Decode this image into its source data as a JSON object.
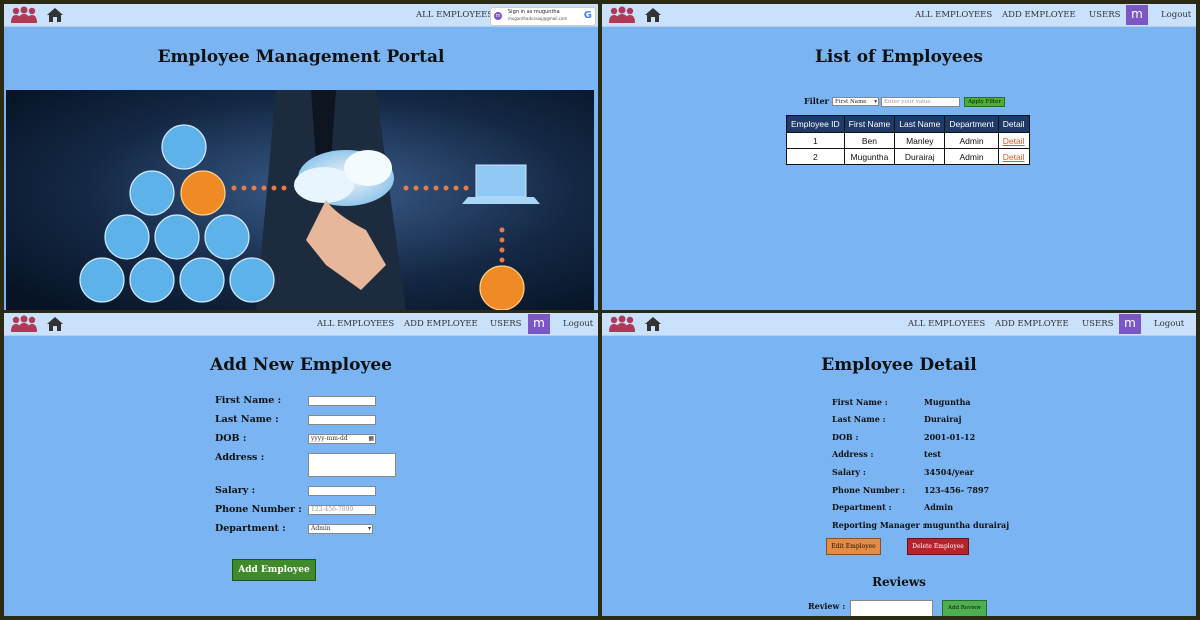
{
  "brand": {
    "logo_color": "#b03a56",
    "home_icon": "home-icon"
  },
  "panel1": {
    "nav": {
      "all_employees": "ALL EMPLOYEES"
    },
    "google_signin": {
      "line1": "Sign in as muguntha",
      "line2": "muganthaduraiaj@gmail.com",
      "avatar_letter": "m",
      "g_letter": "G"
    },
    "title": "Employee Management Portal"
  },
  "panel2": {
    "nav": {
      "all_employees": "ALL EMPLOYEES",
      "add_employee": "ADD EMPLOYEE",
      "users": "USERS",
      "avatar": "m",
      "logout": "Logout"
    },
    "title": "List of Employees",
    "filter": {
      "label": "Filter :",
      "field": "First Name",
      "placeholder": "Enter your value",
      "apply": "Apply Filter"
    },
    "table": {
      "headers": [
        "Employee ID",
        "First Name",
        "Last Name",
        "Department",
        "Detail"
      ],
      "rows": [
        [
          "1",
          "Ben",
          "Manley",
          "Admin",
          "Detail"
        ],
        [
          "2",
          "Muguntha",
          "Durairaj",
          "Admin",
          "Detail"
        ]
      ]
    }
  },
  "panel3": {
    "nav": {
      "all_employees": "ALL EMPLOYEES",
      "add_employee": "ADD EMPLOYEE",
      "users": "USERS",
      "avatar": "m",
      "logout": "Logout"
    },
    "title": "Add New Employee",
    "form": {
      "first_name": "First Name :",
      "last_name": "Last Name :",
      "dob": "DOB :",
      "dob_placeholder": "yyyy-mm-dd",
      "address": "Address :",
      "salary": "Salary :",
      "phone": "Phone Number :",
      "phone_placeholder": "123-456-7890",
      "department": "Department :",
      "department_value": "Admin",
      "submit": "Add Employee"
    }
  },
  "panel4": {
    "nav": {
      "all_employees": "ALL EMPLOYEES",
      "add_employee": "ADD EMPLOYEE",
      "users": "USERS",
      "avatar": "m",
      "logout": "Logout"
    },
    "title": "Employee Detail",
    "details": [
      {
        "label": "First Name :",
        "value": "Muguntha"
      },
      {
        "label": "Last Name :",
        "value": "Durairaj"
      },
      {
        "label": "DOB :",
        "value": "2001-01-12"
      },
      {
        "label": "Address :",
        "value": "test"
      },
      {
        "label": "Salary :",
        "value": "34504/year"
      },
      {
        "label": "Phone Number :",
        "value": "123-456- 7897"
      },
      {
        "label": "Department :",
        "value": "Admin"
      },
      {
        "label": "Reporting Manager :",
        "value": "muguntha durairaj"
      }
    ],
    "edit": "Edit Employee",
    "delete": "Delete Employee",
    "reviews_title": "Reviews",
    "review_label": "Review :",
    "add_review": "Add Review"
  }
}
